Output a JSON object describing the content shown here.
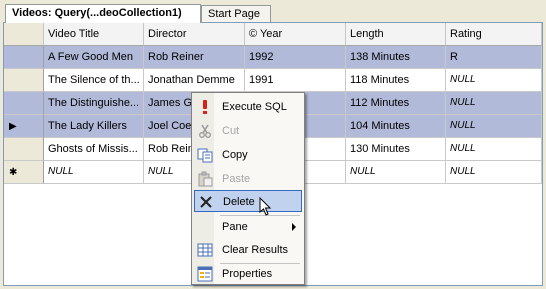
{
  "tabs": [
    {
      "label": "Videos: Query(...deoCollection1)",
      "active": true
    },
    {
      "label": "Start Page",
      "active": false
    }
  ],
  "grid": {
    "columns": [
      "Video Title",
      "Director",
      "© Year",
      "Length",
      "Rating"
    ],
    "rows": [
      {
        "marker": "",
        "selected": true,
        "cells": [
          "A Few Good Men",
          "Rob Reiner",
          "1992",
          "138 Minutes",
          "R"
        ]
      },
      {
        "marker": "",
        "selected": false,
        "cells": [
          "The Silence of th...",
          "Jonathan Demme",
          "1991",
          "118 Minutes",
          "NULL"
        ]
      },
      {
        "marker": "",
        "selected": true,
        "cells": [
          "The Distinguishe...",
          "James Goldst...",
          "",
          "112 Minutes",
          "NULL"
        ]
      },
      {
        "marker": "▶",
        "selected": true,
        "cells": [
          "The Lady Killers",
          "Joel Coen",
          "",
          "104 Minutes",
          "NULL"
        ]
      },
      {
        "marker": "",
        "selected": false,
        "cells": [
          "Ghosts of Missis...",
          "Rob Reiner",
          "",
          "130 Minutes",
          "NULL"
        ]
      },
      {
        "marker": "✱",
        "selected": false,
        "cells": [
          "NULL",
          "NULL",
          "",
          "NULL",
          "NULL"
        ]
      }
    ]
  },
  "context_menu": {
    "items": [
      {
        "label": "Execute SQL",
        "icon": "execute-sql-icon",
        "disabled": false
      },
      {
        "label": "Cut",
        "icon": "scissors-icon",
        "disabled": true
      },
      {
        "label": "Copy",
        "icon": "copy-icon",
        "disabled": false
      },
      {
        "label": "Paste",
        "icon": "paste-icon",
        "disabled": true
      },
      {
        "label": "Delete",
        "icon": "delete-x-icon",
        "disabled": false,
        "hovered": true
      },
      {
        "label": "Pane",
        "icon": "",
        "disabled": false,
        "submenu": true
      },
      {
        "label": "Clear Results",
        "icon": "clear-results-icon",
        "disabled": false
      },
      {
        "label": "Properties",
        "icon": "properties-icon",
        "disabled": false
      }
    ]
  },
  "colors": {
    "selection": "#b1bad9",
    "menu_hover": "#c1d2ee",
    "menu_hover_border": "#316ac5"
  }
}
